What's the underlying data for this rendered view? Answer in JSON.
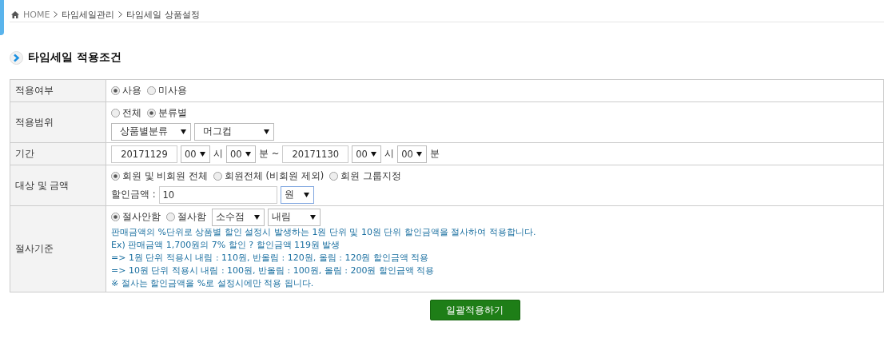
{
  "breadcrumb": [
    "HOME",
    "타임세일관리",
    "타임세일 상품설정"
  ],
  "section_title": "타임세일 적용조건",
  "rows": [
    {
      "label": "적용여부",
      "lines": [
        [
          {
            "kind": "radio",
            "label": "사용",
            "selected": true
          },
          {
            "kind": "radio",
            "label": "미사용",
            "selected": false
          }
        ]
      ]
    },
    {
      "label": "적용범위",
      "lines": [
        [
          {
            "kind": "radio",
            "label": "전체",
            "selected": false
          },
          {
            "kind": "radio",
            "label": "분류별",
            "selected": true
          }
        ],
        [
          {
            "kind": "category",
            "value": "상품별분류"
          },
          {
            "kind": "category",
            "value": "머그컵"
          }
        ]
      ]
    },
    {
      "label": "기간",
      "lines": [
        [
          {
            "kind": "date",
            "value": "20171129"
          },
          {
            "kind": "time",
            "value": "00"
          },
          {
            "kind": "text",
            "text": "시"
          },
          {
            "kind": "time",
            "value": "00"
          },
          {
            "kind": "text",
            "text": "분 ~"
          },
          {
            "kind": "date",
            "value": "20171130"
          },
          {
            "kind": "time",
            "value": "00"
          },
          {
            "kind": "text",
            "text": "시"
          },
          {
            "kind": "time",
            "value": "00"
          },
          {
            "kind": "text",
            "text": "분"
          }
        ]
      ]
    },
    {
      "label": "대상 및 금액",
      "lines": [
        [
          {
            "kind": "radio",
            "label": "회원 및 비회원 전체",
            "selected": true
          },
          {
            "kind": "radio",
            "label": "회원전체 (비회원 제외)",
            "selected": false
          },
          {
            "kind": "radio",
            "label": "회원 그룹지정",
            "selected": false
          }
        ],
        [
          {
            "kind": "text",
            "text": "할인금액 :"
          },
          {
            "kind": "amount",
            "value": "10"
          },
          {
            "kind": "unit",
            "value": "원",
            "focused": true
          }
        ]
      ]
    },
    {
      "label": "절사기준",
      "lines": [
        [
          {
            "kind": "radio",
            "label": "절사안함",
            "selected": true
          },
          {
            "kind": "radio",
            "label": "절사함",
            "selected": false
          },
          {
            "kind": "option",
            "value": "소수점"
          },
          {
            "kind": "option",
            "value": "내림"
          }
        ],
        [
          {
            "kind": "note",
            "text": "판매금액의 %단위로 상품별 할인 설정시 발생하는 1원 단위 및 10원 단위 할인금액을 절사하여 적용합니다."
          }
        ],
        [
          {
            "kind": "note",
            "text": "Ex) 판매금액 1,700원의 7% 할인 ? 할인금액 119원 발생"
          }
        ],
        [
          {
            "kind": "note",
            "text": "=> 1원 단위 적용시 내림 : 110원, 반올림 : 120원, 올림 : 120원 할인금액 적용"
          }
        ],
        [
          {
            "kind": "note",
            "text": "=> 10원 단위 적용시 내림 : 100원, 반올림 : 100원, 올림 : 200원 할인금액 적용"
          }
        ],
        [
          {
            "kind": "note",
            "text": "※ 절사는 할인금액을 %로 설정시에만 적용 됩니다."
          }
        ]
      ]
    }
  ],
  "submit_button": "일괄적용하기"
}
